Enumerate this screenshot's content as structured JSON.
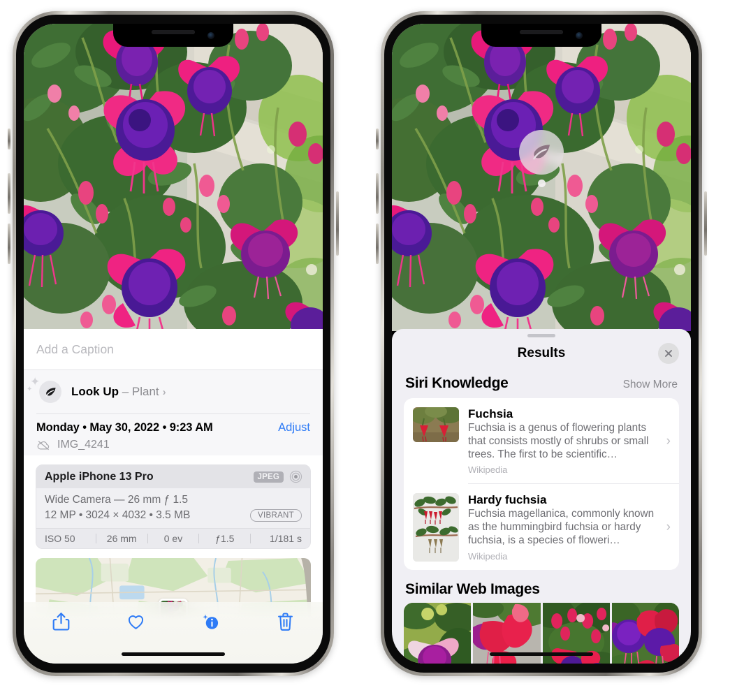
{
  "left_phone": {
    "photo_alt": "fuchsia-flowers-photo",
    "caption_placeholder": "Add a Caption",
    "lookup": {
      "icon": "leaf-icon",
      "label": "Look Up",
      "dash": " – ",
      "subject": "Plant",
      "chevron": "›"
    },
    "metadata": {
      "date_line": "Monday • May 30, 2022 • 9:23 AM",
      "adjust_label": "Adjust",
      "cloud_icon": "cloud-slash-icon",
      "filename": "IMG_4241"
    },
    "camera_card": {
      "model": "Apple iPhone 13 Pro",
      "format_badge": "JPEG",
      "hdr_icon": "hdr-circle-icon",
      "lens_line": "Wide Camera — 26 mm ƒ 1.5",
      "specs_line": "12 MP • 3024 × 4032 • 3.5 MB",
      "style_badge": "VIBRANT",
      "exif": [
        "ISO 50",
        "26 mm",
        "0 ev",
        "ƒ1.5",
        "1/181 s"
      ]
    },
    "map": {
      "name": "map-thumbnail",
      "pin": "photo-pin"
    },
    "toolbar": [
      {
        "name": "share-button",
        "icon": "share-icon"
      },
      {
        "name": "favorite-button",
        "icon": "heart-icon"
      },
      {
        "name": "info-button",
        "icon": "info-sparkle-icon"
      },
      {
        "name": "delete-button",
        "icon": "trash-icon"
      }
    ],
    "accent_color": "#2e7bf6"
  },
  "right_phone": {
    "photo_alt": "fuchsia-flowers-photo",
    "visual_lookup_badge": {
      "icon": "leaf-icon",
      "name": "visual-lookup-badge"
    },
    "sheet": {
      "grabber": "sheet-grabber",
      "title": "Results",
      "close_icon": "close-icon"
    },
    "siri_knowledge": {
      "section_title": "Siri Knowledge",
      "show_more": "Show More",
      "items": [
        {
          "title": "Fuchsia",
          "description": "Fuchsia is a genus of flowering plants that consists mostly of shrubs or small trees. The first to be scientific…",
          "source": "Wikipedia",
          "chevron": "›"
        },
        {
          "title": "Hardy fuchsia",
          "description": "Fuchsia magellanica, commonly known as the hummingbird fuchsia or hardy fuchsia, is a species of floweri…",
          "source": "Wikipedia",
          "chevron": "›"
        }
      ]
    },
    "similar_web_images": {
      "section_title": "Similar Web Images",
      "thumbnails": [
        "fuchsia-thumb-1",
        "fuchsia-thumb-2",
        "fuchsia-thumb-3",
        "fuchsia-thumb-4"
      ]
    },
    "panel_color": "#f0eff4"
  }
}
